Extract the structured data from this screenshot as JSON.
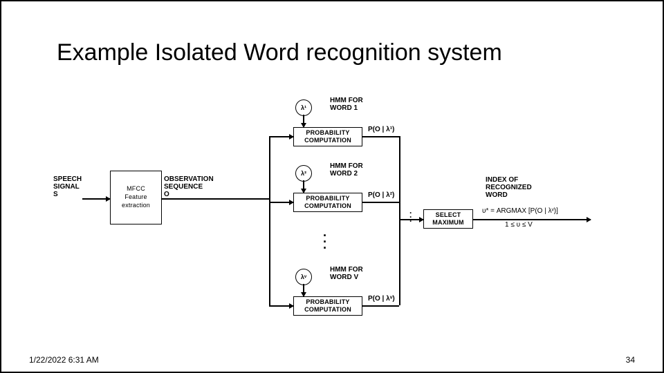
{
  "title": "Example Isolated Word recognition system",
  "footer": {
    "date": "1/22/2022 6:31 AM",
    "page": "34"
  },
  "diagram": {
    "input": {
      "line1": "SPEECH",
      "line2": "SIGNAL",
      "line3": "S"
    },
    "mfcc": {
      "line1": "MFCC",
      "line2": "Feature",
      "line3": "extraction"
    },
    "obs": {
      "line1": "OBSERVATION",
      "line2": "SEQUENCE",
      "line3": "O"
    },
    "lambda": {
      "l1": "λ¹",
      "l2": "λ²",
      "lv": "λᵛ"
    },
    "hmm": {
      "w1": "HMM FOR\nWORD 1",
      "w2": "HMM FOR\nWORD 2",
      "wv": "HMM FOR\nWORD V"
    },
    "pcomp": "PROBABILITY\nCOMPUTATION",
    "prob": {
      "p1": "P(O | λ¹)",
      "p2": "P(O | λ²)",
      "pv": "P(O | λᵛ)"
    },
    "select": "SELECT\nMAXIMUM",
    "output": {
      "line1": "INDEX OF",
      "line2": "RECOGNIZED",
      "line3": "WORD"
    },
    "formula": {
      "line1": "υ* = ARGMAX [P(O | λᵛ)]",
      "line2": "1 ≤ υ ≤ V"
    },
    "dots": "·\n·\n·"
  }
}
